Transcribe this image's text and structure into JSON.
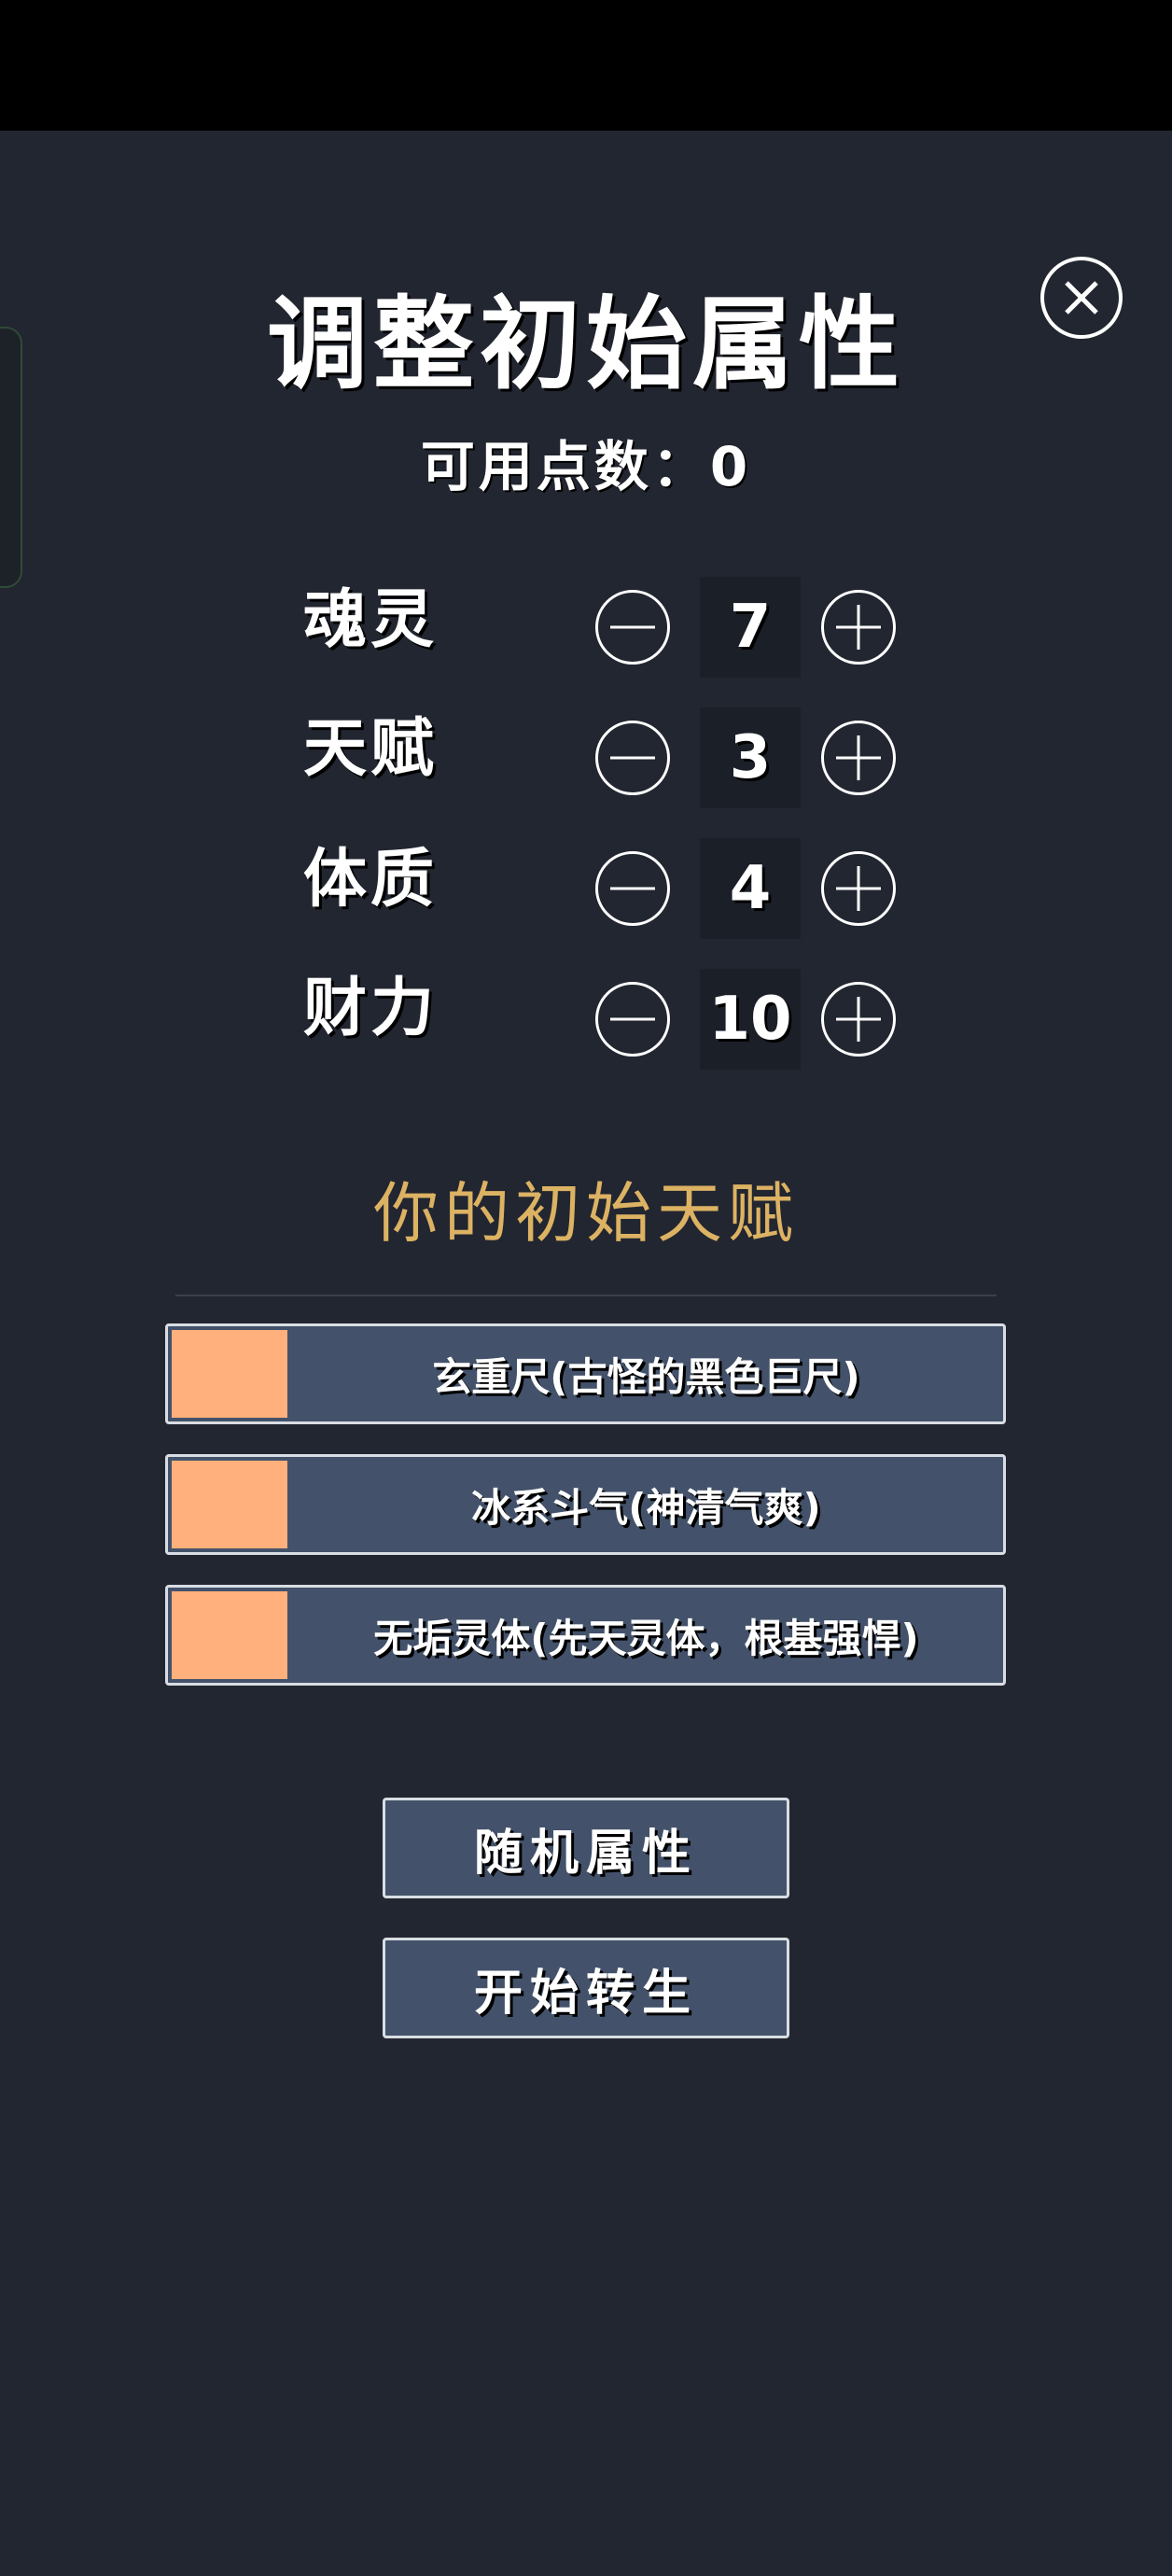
{
  "header": {
    "title": "调整初始属性"
  },
  "points": {
    "label": "可用点数：",
    "value": "0"
  },
  "attributes": [
    {
      "label": "魂灵",
      "value": "7"
    },
    {
      "label": "天赋",
      "value": "3"
    },
    {
      "label": "体质",
      "value": "4"
    },
    {
      "label": "财力",
      "value": "10"
    }
  ],
  "talents": {
    "heading": "你的初始天赋",
    "items": [
      {
        "text": "玄重尺(古怪的黑色巨尺)",
        "color": "#ffb07c"
      },
      {
        "text": "冰系斗气(神清气爽)",
        "color": "#ffb07c"
      },
      {
        "text": "无垢灵体(先天灵体，根基强悍)",
        "color": "#ffb07c"
      }
    ]
  },
  "actions": {
    "random_label": "随机属性",
    "start_label": "开始转生"
  },
  "icons": {
    "close": "close-icon",
    "minus": "minus-circle-icon",
    "plus": "plus-circle-icon"
  },
  "colors": {
    "background": "#222630",
    "accent": "#dcb263",
    "button": "#43526a",
    "talent_swatch": "#ffb07c"
  }
}
